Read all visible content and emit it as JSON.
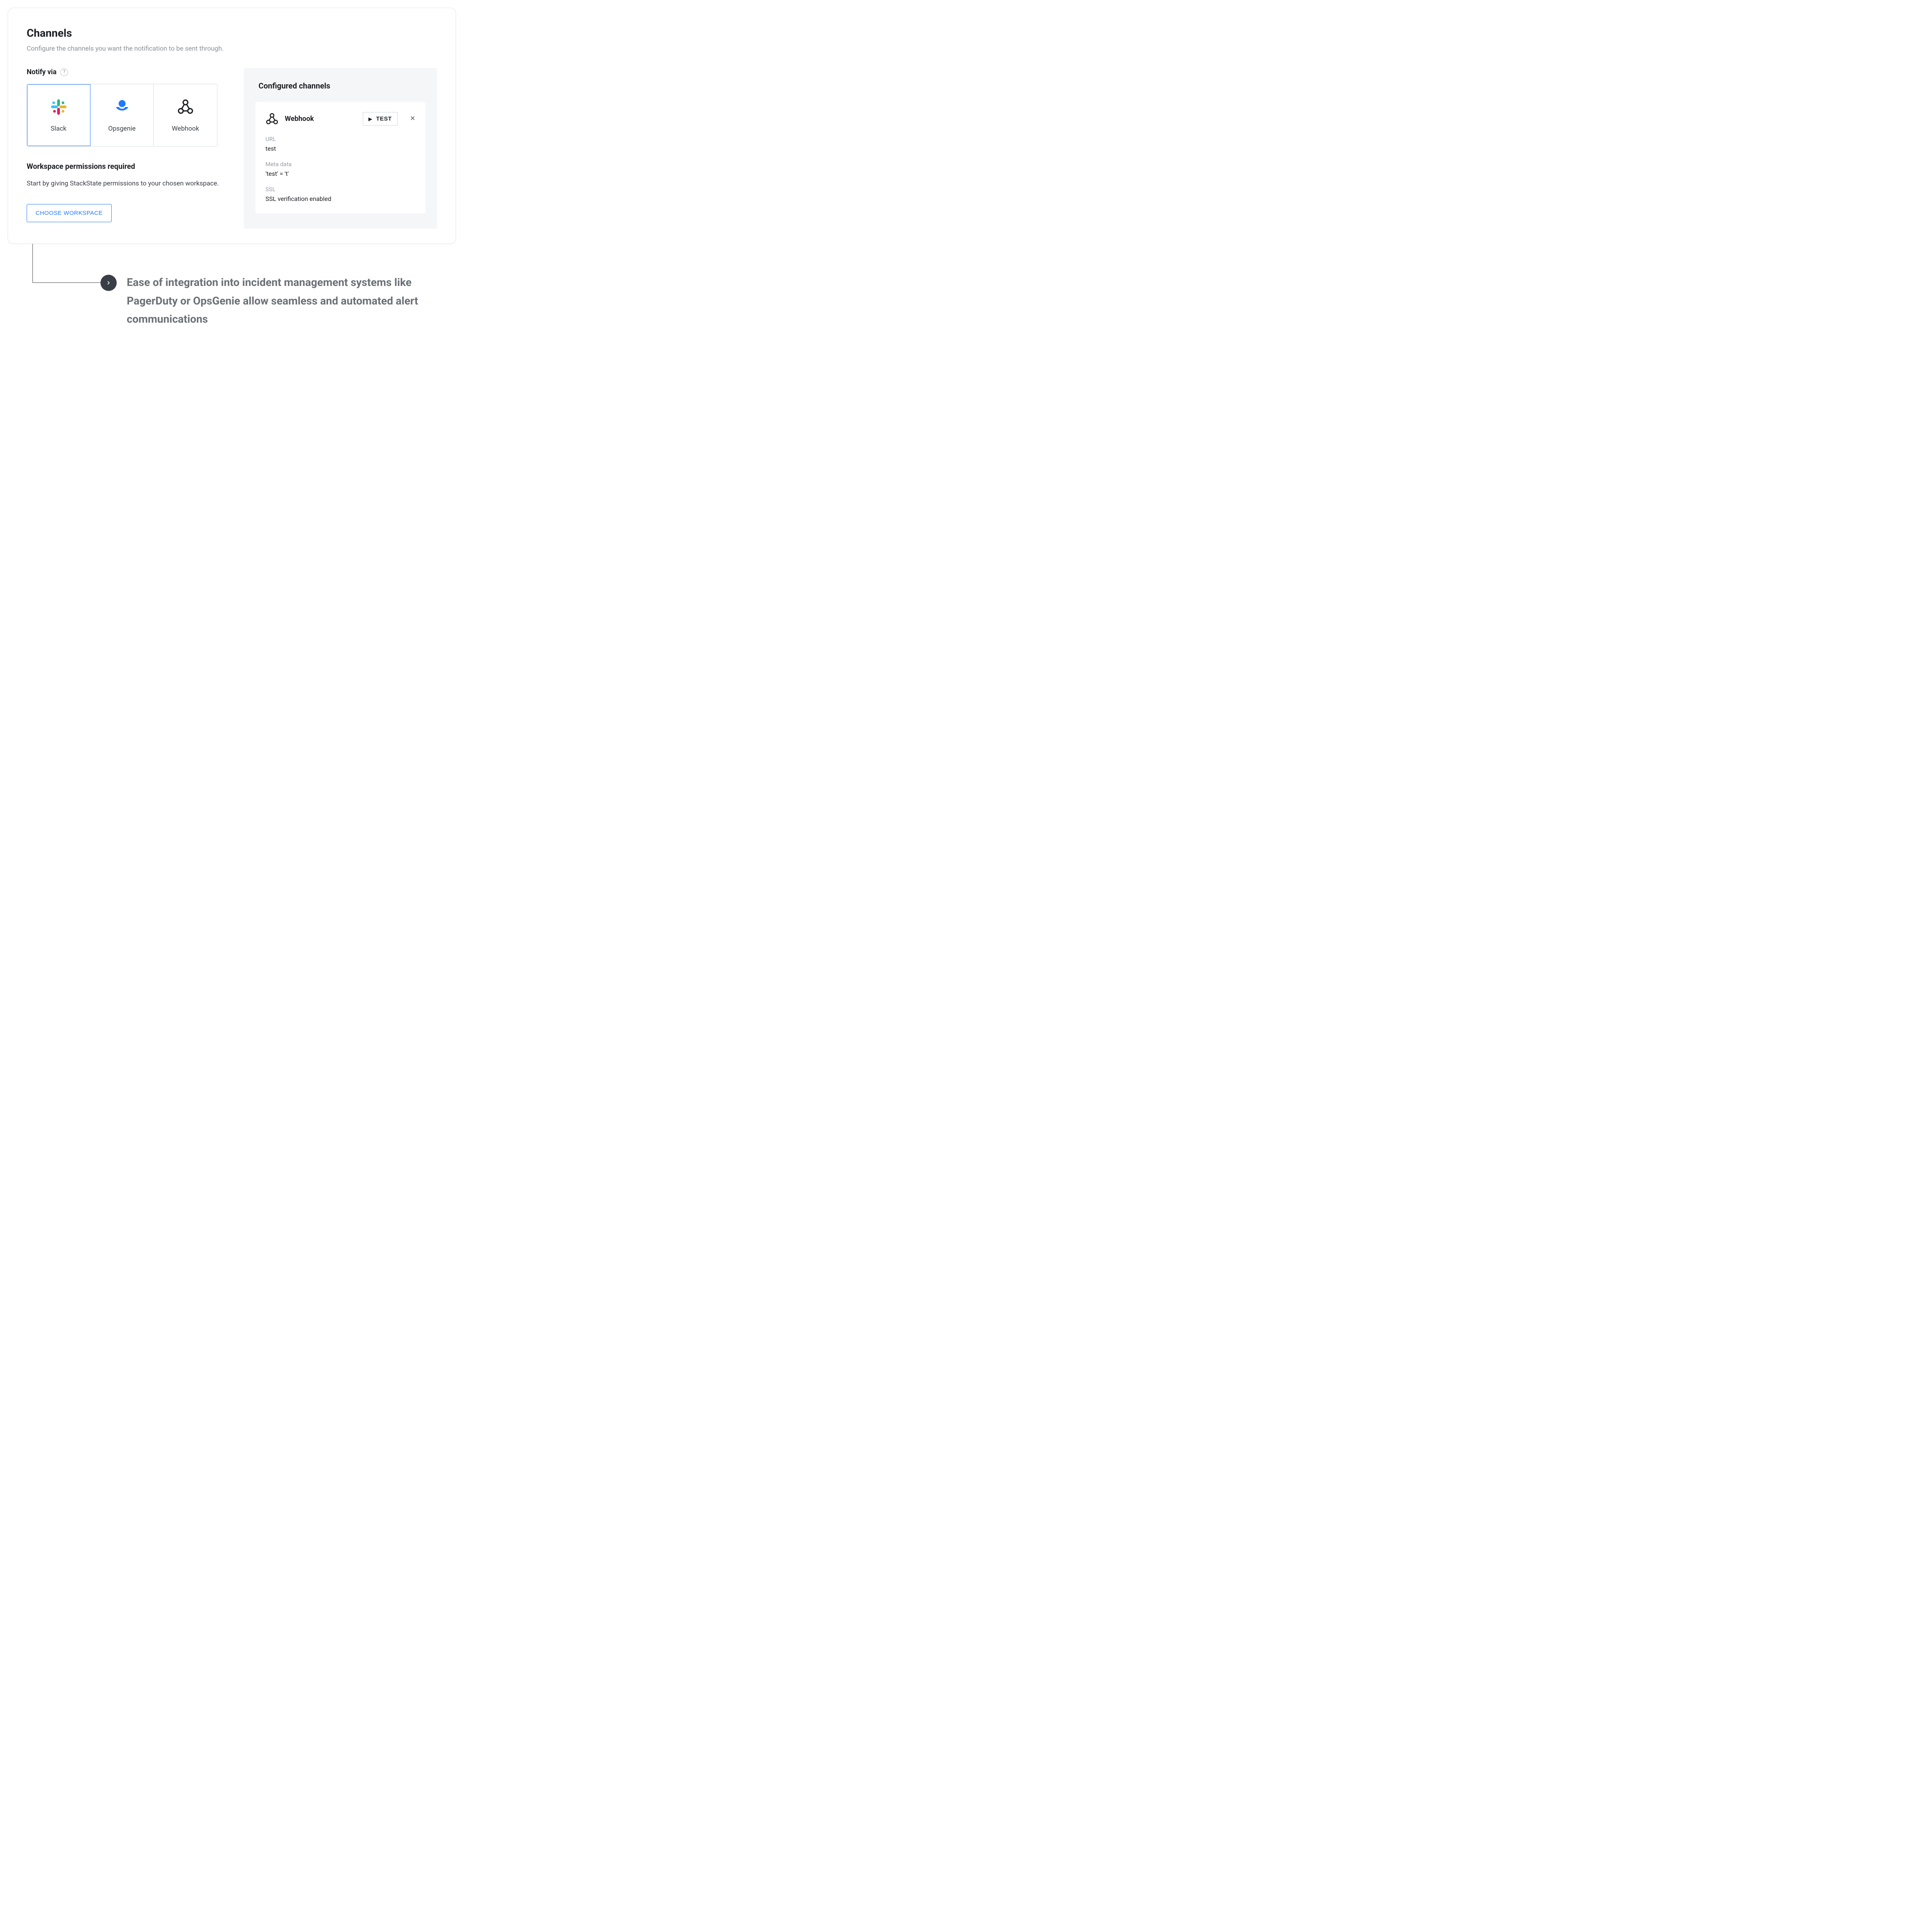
{
  "header": {
    "title": "Channels",
    "subtitle": "Configure the channels you want the notification to be sent through."
  },
  "notify": {
    "label": "Notify via",
    "options": [
      {
        "name": "Slack",
        "icon": "slack-icon"
      },
      {
        "name": "Opsgenie",
        "icon": "opsgenie-icon"
      },
      {
        "name": "Webhook",
        "icon": "webhook-icon"
      }
    ]
  },
  "permissions": {
    "heading": "Workspace permissions required",
    "body": "Start by giving StackState permissions to your chosen workspace.",
    "button": "CHOOSE WORKSPACE"
  },
  "configured": {
    "heading": "Configured channels",
    "items": [
      {
        "type": "Webhook",
        "test_label": "TEST",
        "fields": {
          "url_label": "URL",
          "url_value": "test",
          "meta_label": "Meta data",
          "meta_value": "'test' = 't'",
          "ssl_label": "SSL",
          "ssl_value": "SSL verification enabled"
        }
      }
    ]
  },
  "annotation": {
    "text": "Ease of integration into incident management systems like PagerDuty or OpsGenie allow seamless and automated alert communications"
  }
}
